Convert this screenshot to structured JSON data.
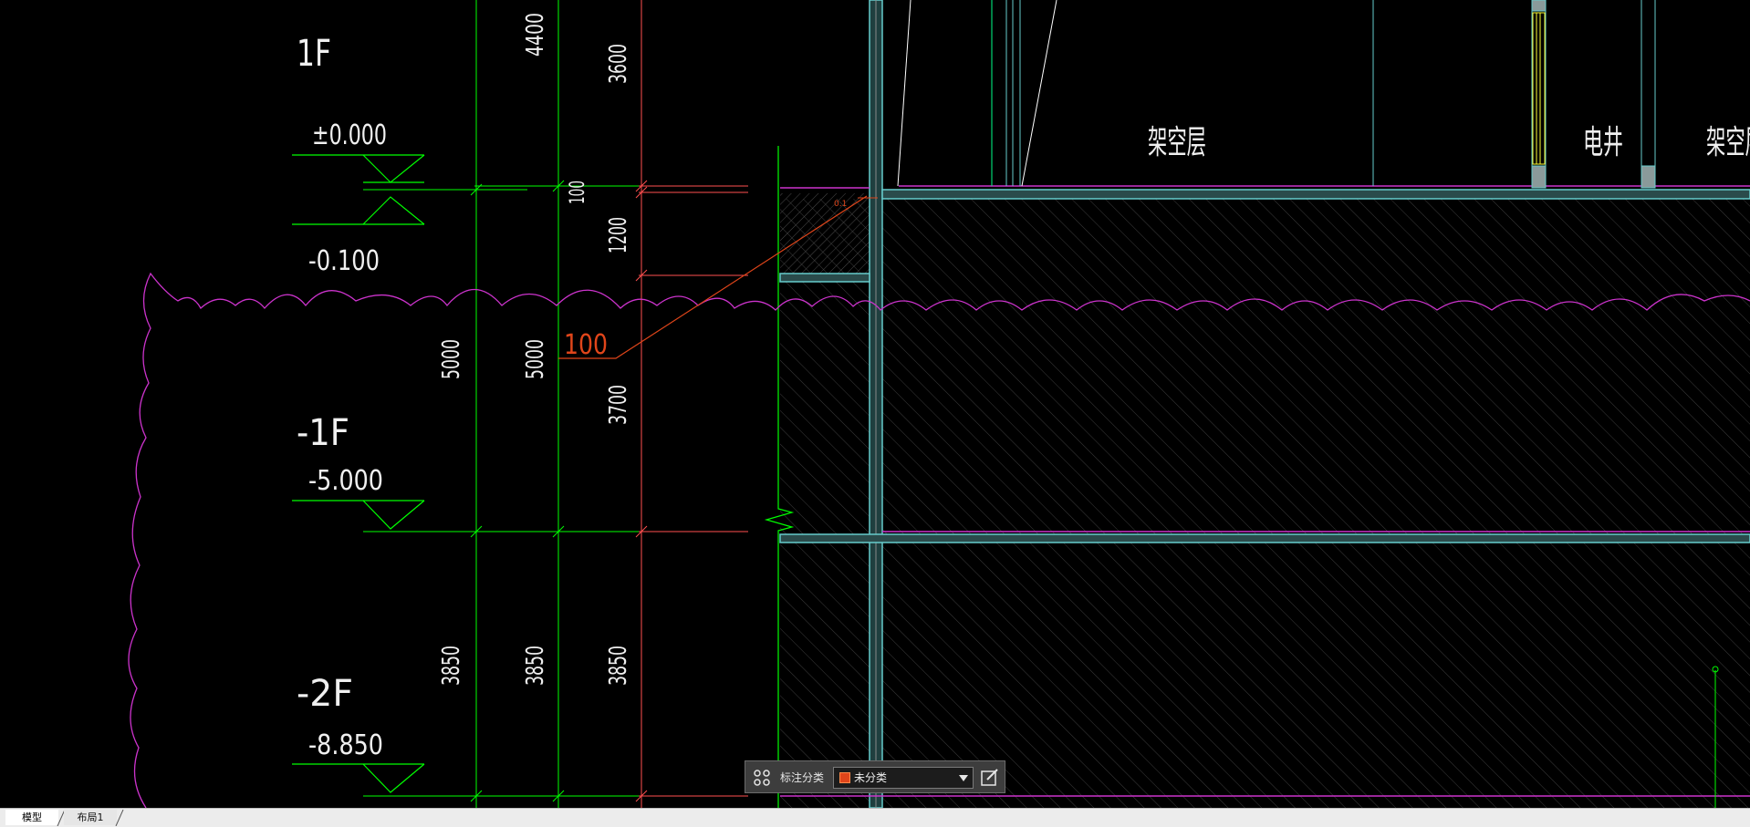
{
  "drawing": {
    "floors": [
      {
        "name": "1F",
        "elevation": "±0.000"
      },
      {
        "name": "-1F",
        "elevation": "-5.000"
      },
      {
        "name": "-2F",
        "elevation": "-8.850"
      }
    ],
    "sub_elevation": "-0.100",
    "dimensions": {
      "col1": [
        "5000",
        "3850"
      ],
      "col2": [
        "4400",
        "5000",
        "3850"
      ],
      "col3_small": "100",
      "col4": [
        "3600",
        "1200",
        "3700",
        "3850"
      ]
    },
    "leader_label": "100",
    "small_mark": "0.1",
    "rooms": [
      "架空层",
      "电井",
      "架空层"
    ]
  },
  "toolbar": {
    "label": "标注分类",
    "select_value": "未分类",
    "swatch_color": "#e0451a"
  },
  "tabs": [
    "模型",
    "布局1"
  ],
  "colors": {
    "dimension_green": "#00ff00",
    "dimension_red": "#ff5050",
    "revision_cloud_magenta": "#cc33cc",
    "wall_cyan": "#66cccc",
    "leader_orange": "#e0451a",
    "highlight_yellow": "#ffff33"
  }
}
